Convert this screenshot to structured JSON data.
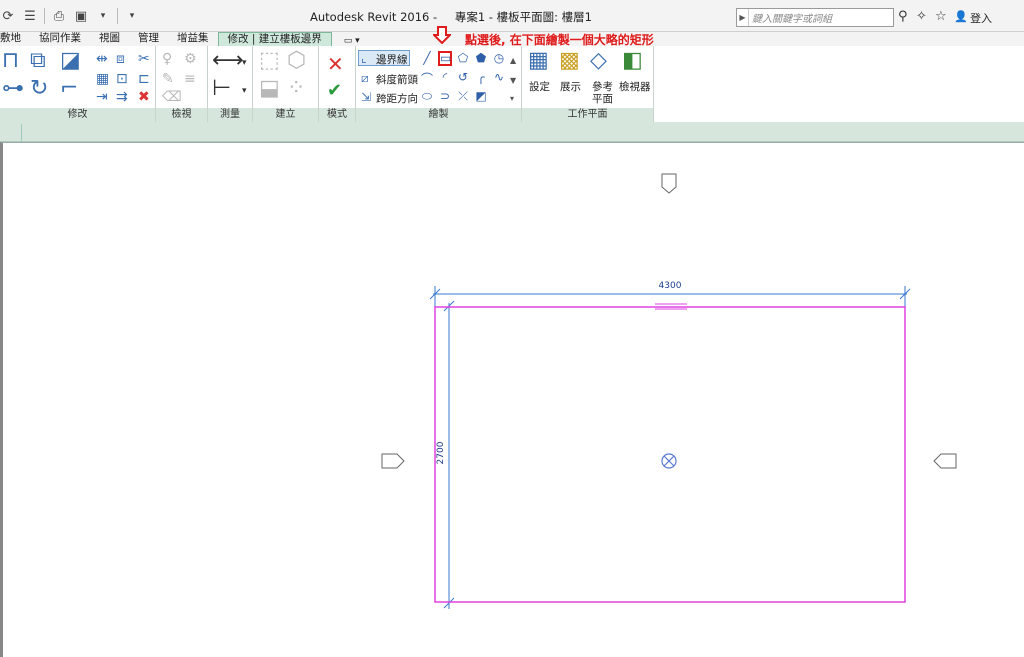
{
  "window": {
    "app_title": "Autodesk Revit 2016 -",
    "project_title": "專案1 - 樓板平面圖: 樓層1"
  },
  "search": {
    "placeholder": "鍵入關鍵字或詞組"
  },
  "account": {
    "login_label": "登入"
  },
  "ribbon_tabs": [
    {
      "label": "敷地"
    },
    {
      "label": "協同作業"
    },
    {
      "label": "視圖"
    },
    {
      "label": "管理"
    },
    {
      "label": "增益集"
    },
    {
      "label": "修改 | 建立樓板邊界",
      "active": true
    }
  ],
  "panels": {
    "modify": "修改",
    "view": "檢視",
    "measure": "測量",
    "create": "建立",
    "mode": "模式",
    "draw": "繪製",
    "work_plane": "工作平面"
  },
  "draw_tools": {
    "boundary_line": "邊界線",
    "slope_arrow": "斜度箭頭",
    "span_direction": "跨距方向"
  },
  "work_plane_tools": {
    "set": "設定",
    "show": "展示",
    "ref_plane_1": "參考",
    "ref_plane_2": "平面",
    "viewer": "檢視器"
  },
  "annotation": {
    "hint_text": "點選後, 在下面繪製一個大略的矩形",
    "hint_color": "#e01b1b"
  },
  "canvas": {
    "dimension_width": "4300",
    "dimension_height": "2700",
    "sketch_color": "#e040e0",
    "dimension_color": "#3a78d0"
  },
  "colors": {
    "ribbon_tab_active": "#cfe8dc",
    "panel_label_bg": "#d6e6dd"
  }
}
